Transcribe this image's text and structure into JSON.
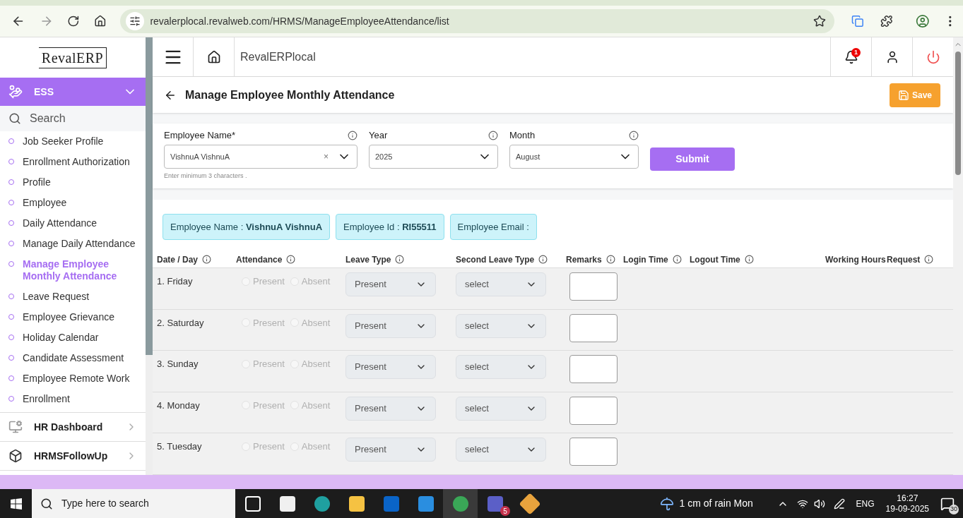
{
  "browser": {
    "url": "revalerplocal.revalweb.com/HRMS/ManageEmployeeAttendance/list"
  },
  "sidebar": {
    "logo": "RevalERP",
    "search": {
      "placeholder": "Search"
    },
    "modules": [
      {
        "label": "ESS",
        "expanded": true,
        "items": [
          {
            "label": "Job Seeker Profile",
            "selected": false
          },
          {
            "label": "Enrollment Authorization",
            "selected": false
          },
          {
            "label": "Profile",
            "selected": false
          },
          {
            "label": "Employee",
            "selected": false
          },
          {
            "label": "Daily Attendance",
            "selected": false
          },
          {
            "label": "Manage Daily Attendance",
            "selected": false
          },
          {
            "label": "Manage Employee Monthly Attendance",
            "selected": true
          },
          {
            "label": "Leave Request",
            "selected": false
          },
          {
            "label": "Employee Grievance",
            "selected": false
          },
          {
            "label": "Holiday Calendar",
            "selected": false
          },
          {
            "label": "Candidate Assessment",
            "selected": false
          },
          {
            "label": "Employee Remote Work",
            "selected": false
          },
          {
            "label": "Enrollment",
            "selected": false
          }
        ]
      },
      {
        "label": "HR Dashboard",
        "expanded": false,
        "kind": "dashboard"
      },
      {
        "label": "HRMSFollowUp",
        "expanded": false,
        "kind": "cube"
      }
    ]
  },
  "header": {
    "app_name": "RevalERPlocal",
    "notification_count": "1"
  },
  "page": {
    "title": "Manage Employee Monthly Attendance",
    "save_label": "Save"
  },
  "filters": [
    {
      "label": "Employee Name*",
      "value": "VishnuA VishnuA",
      "hint": "Enter minimum 3 characters .",
      "clear_label": "×"
    },
    {
      "label": "Year",
      "value": "2025"
    },
    {
      "label": "Month",
      "value": "August"
    }
  ],
  "submit_label": "Submit",
  "chips": [
    {
      "label": "Employee Name : ",
      "value": "VishnuA VishnuA"
    },
    {
      "label": "Employee Id : ",
      "value": "RI55511"
    },
    {
      "label": "Employee Email :"
    }
  ],
  "table": {
    "columns": [
      "Date / Day",
      "Attendance",
      "Leave Type",
      "Second Leave Type",
      "Remarks",
      "Login Time",
      "Logout Time",
      "Working Hours",
      "Request"
    ],
    "rows": [
      {
        "day": "1. Friday",
        "present": false,
        "absent": false,
        "present_label": "Present",
        "absent_label": "Absent",
        "leave_type": "Present",
        "second_leave_type": "select"
      },
      {
        "day": "2. Saturday",
        "present": false,
        "absent": false,
        "present_label": "Present",
        "absent_label": "Absent",
        "leave_type": "Present",
        "second_leave_type": "select"
      },
      {
        "day": "3. Sunday",
        "present": false,
        "absent": false,
        "present_label": "Present",
        "absent_label": "Absent",
        "leave_type": "Present",
        "second_leave_type": "select"
      },
      {
        "day": "4. Monday",
        "present": false,
        "absent": false,
        "present_label": "Present",
        "absent_label": "Absent",
        "leave_type": "Present",
        "second_leave_type": "select"
      },
      {
        "day": "5. Tuesday",
        "present": false,
        "absent": false,
        "present_label": "Present",
        "absent_label": "Absent",
        "leave_type": "Present",
        "second_leave_type": "select"
      }
    ]
  },
  "taskbar": {
    "search_placeholder": "Type here to search",
    "teams_badge": "5",
    "weather": "1 cm of rain Mon",
    "language": "ENG",
    "time": "16:27",
    "date": "19-09-2025",
    "notifications": "30"
  }
}
